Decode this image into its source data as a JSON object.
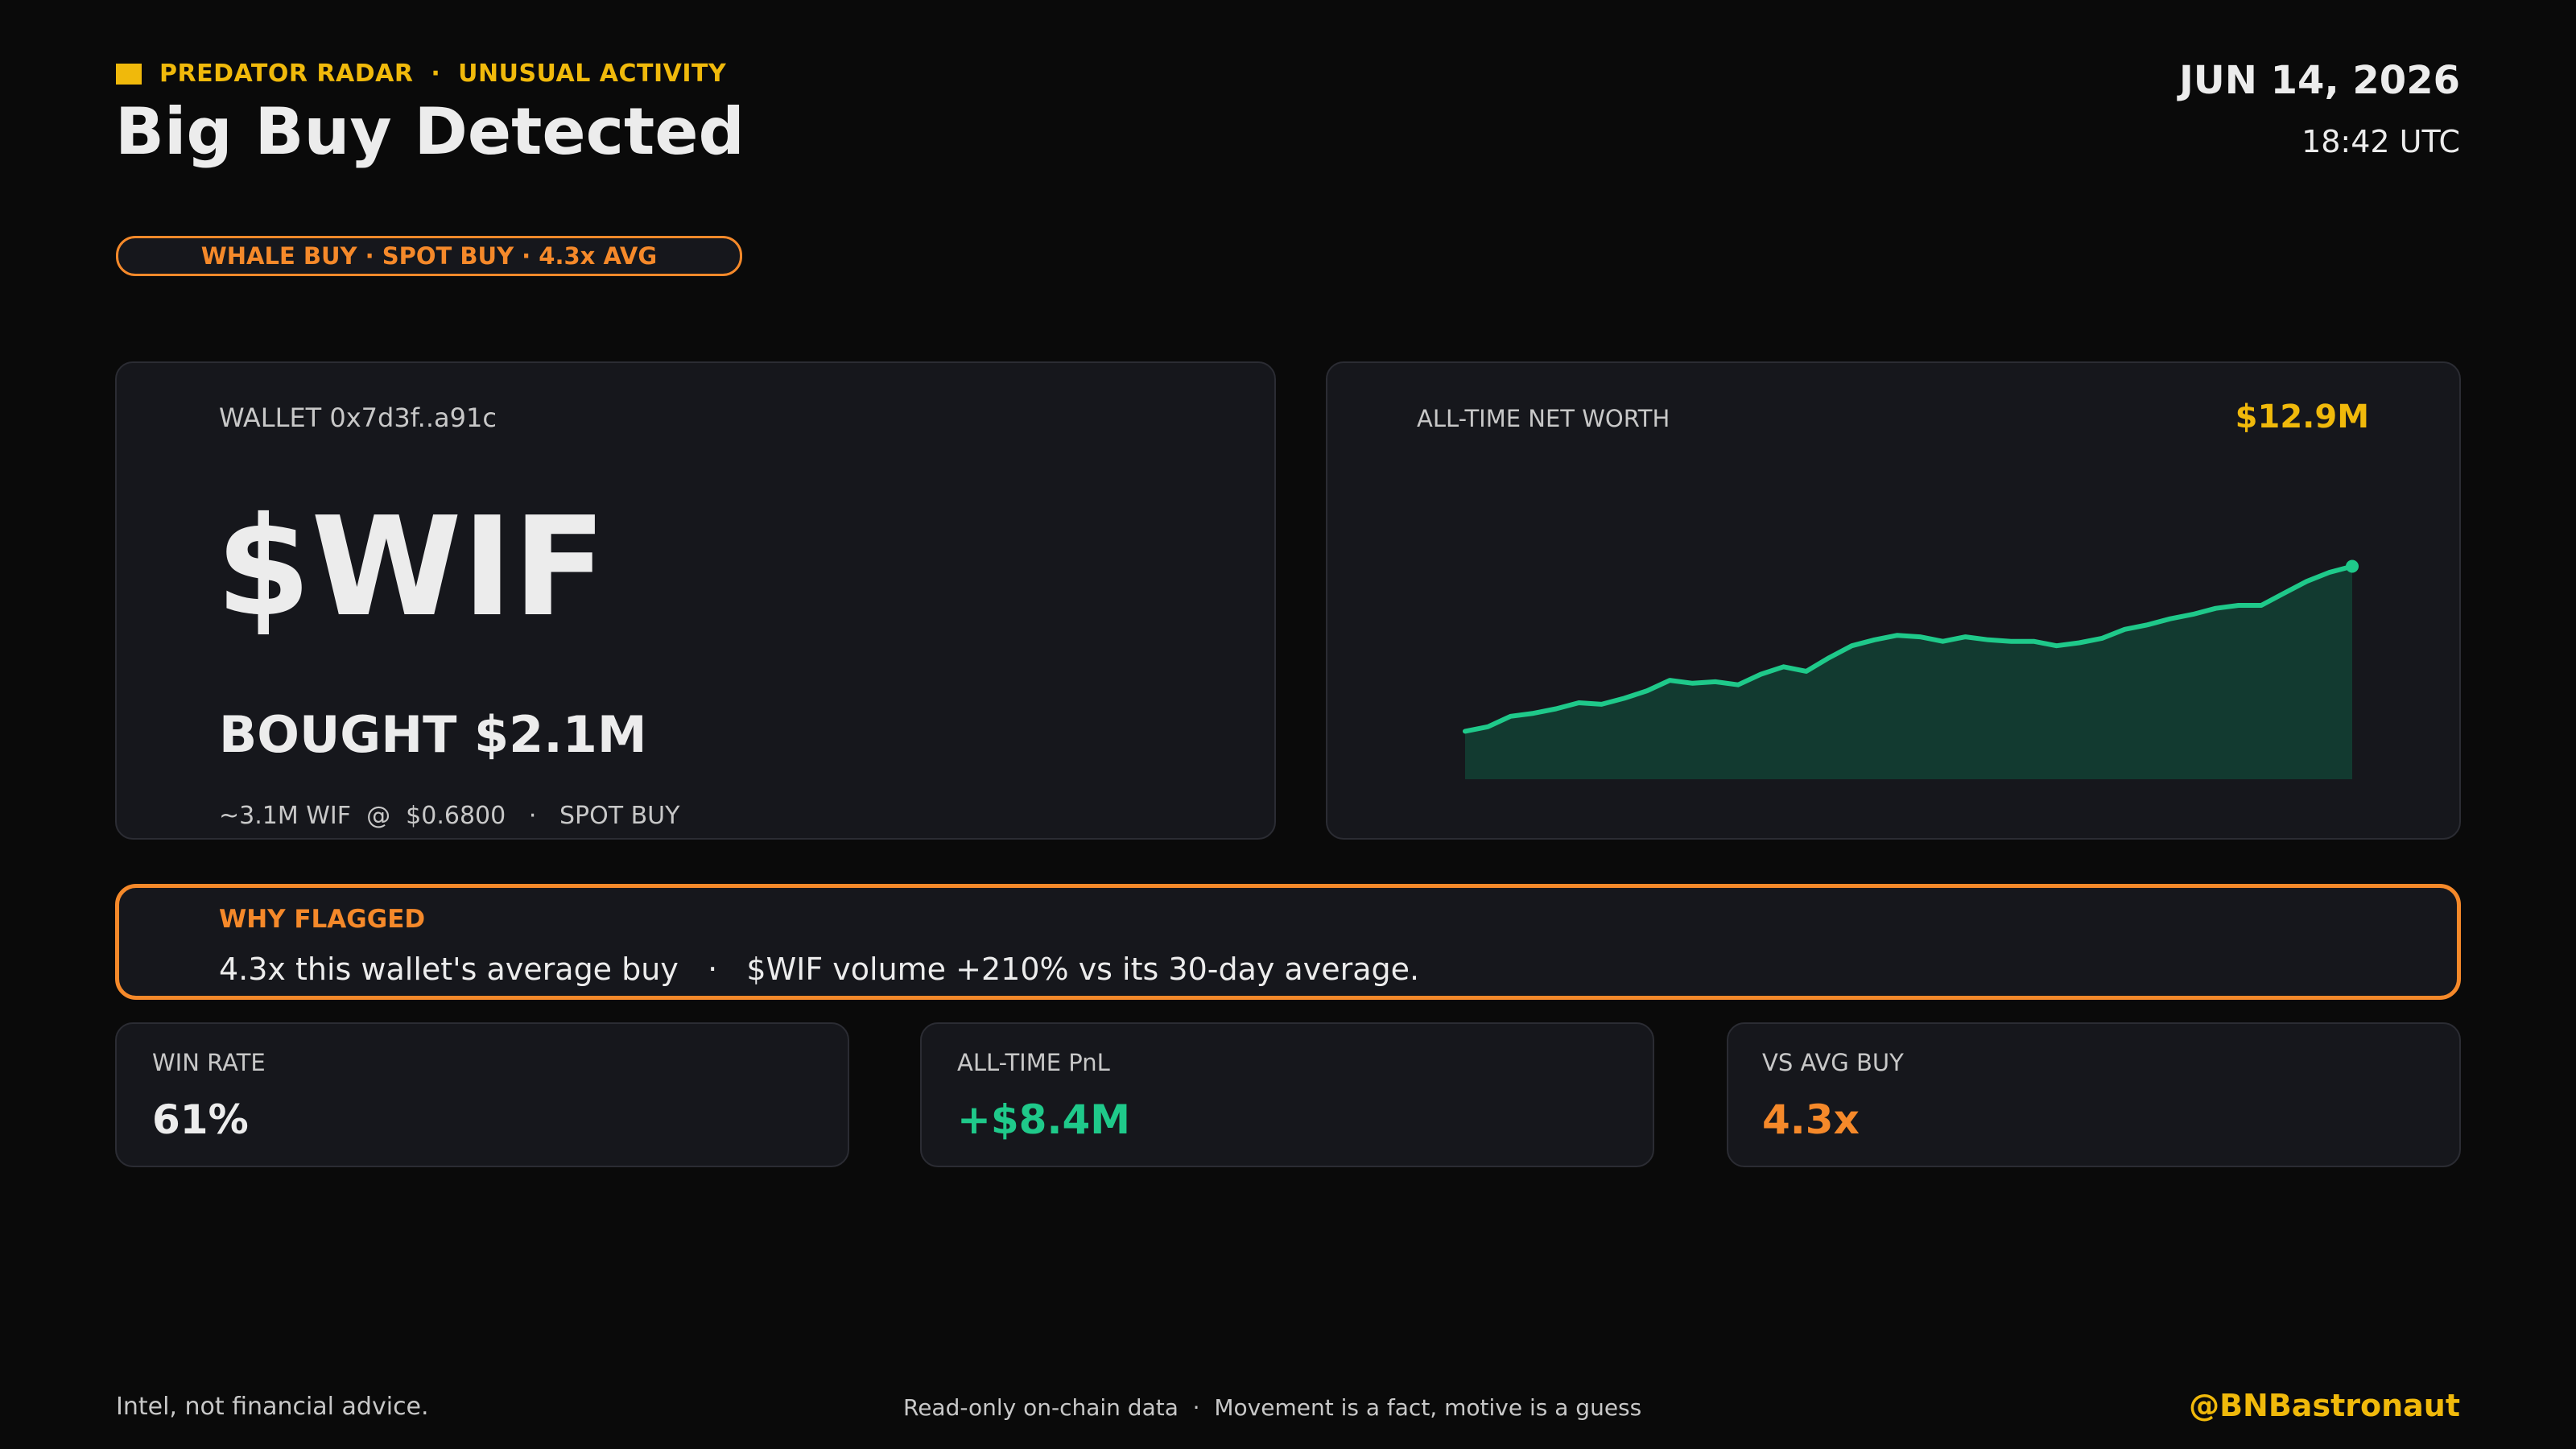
{
  "header": {
    "brand": "PREDATOR RADAR",
    "separator": "·",
    "tag": "UNUSUAL ACTIVITY",
    "title": "Big Buy Detected",
    "date": "JUN 14, 2026",
    "time": "18:42 UTC",
    "pill": "WHALE BUY · SPOT BUY · 4.3x AVG"
  },
  "wallet_card": {
    "label": "WALLET 0x7d3f..a91c",
    "token": "$WIF",
    "bought": "BOUGHT $2.1M",
    "detail": "~3.1M WIF  @  $0.6800   ·   SPOT BUY"
  },
  "networth_card": {
    "label": "ALL-TIME NET WORTH",
    "value": "$12.9M"
  },
  "chart_data": {
    "type": "area",
    "title": "",
    "xlabel": "",
    "ylabel": "",
    "values": [
      3.2,
      3.5,
      4.2,
      4.4,
      4.7,
      5.1,
      5.0,
      5.4,
      5.9,
      6.6,
      6.4,
      6.5,
      6.3,
      7.0,
      7.5,
      7.2,
      8.1,
      8.9,
      9.3,
      9.6,
      9.5,
      9.2,
      9.5,
      9.3,
      9.2,
      9.2,
      8.9,
      9.1,
      9.4,
      10.0,
      10.3,
      10.7,
      11.0,
      11.4,
      11.6,
      11.6,
      12.4,
      13.2,
      13.8,
      14.2
    ],
    "ylim": [
      0,
      16
    ],
    "line_color": "#1fc98a",
    "fill_color": "#123a30"
  },
  "flag": {
    "title": "WHY FLAGGED",
    "text": "4.3x this wallet's average buy   ·   $WIF volume +210% vs its 30-day average."
  },
  "stats": [
    {
      "label": "WIN RATE",
      "value": "61%",
      "color": "#ececec"
    },
    {
      "label": "ALL-TIME PnL",
      "value": "+$8.4M",
      "color": "#1fc98a"
    },
    {
      "label": "VS AVG BUY",
      "value": "4.3x",
      "color": "#f5892a"
    }
  ],
  "footer": {
    "left": "Intel, not financial advice.",
    "center": "Read-only on-chain data  ·  Movement is a fact, motive is a guess",
    "handle": "@BNBastronaut"
  },
  "colors": {
    "accent_yellow": "#f0b90b",
    "accent_orange": "#f5892a",
    "positive_green": "#1fc98a",
    "background": "#0a0a0a",
    "card": "#16171c"
  }
}
